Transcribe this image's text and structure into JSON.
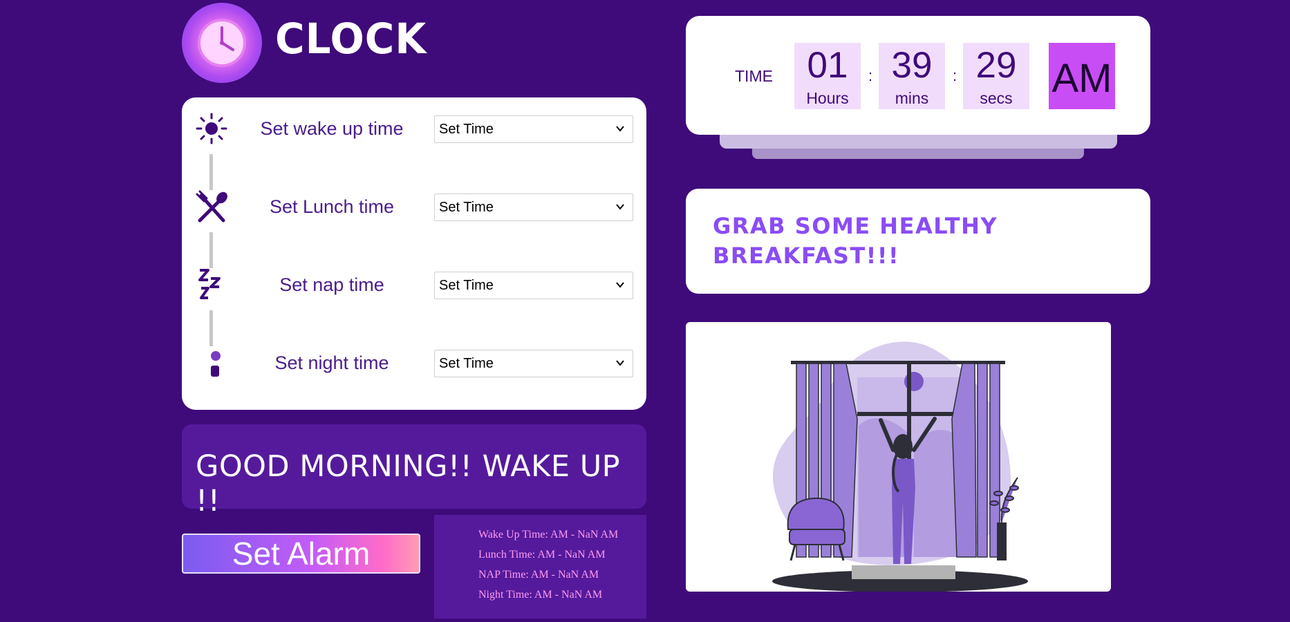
{
  "app": {
    "logo_text": "CLOCK",
    "logo_icon": "clock-icon"
  },
  "schedule": {
    "rows": [
      {
        "icon": "sun-icon",
        "label": "Set wake up time",
        "select_value": "Set Time"
      },
      {
        "icon": "fork-spoon-icon",
        "label": "Set Lunch time",
        "select_value": "Set Time"
      },
      {
        "icon": "zzz-icon",
        "label": "Set nap time",
        "select_value": "Set Time"
      },
      {
        "icon": "moon-icon",
        "label": "Set night time",
        "select_value": "Set Time"
      }
    ]
  },
  "greeting": {
    "text": "GOOD MORNING!! WAKE UP !!"
  },
  "alarm_button": {
    "label": "Set Alarm"
  },
  "alarms": [
    "Wake Up Time: AM - NaN AM",
    "Lunch Time: AM - NaN AM",
    "NAP Time: AM - NaN AM",
    "Night Time: AM - NaN AM"
  ],
  "clock": {
    "label": "TIME",
    "hours": "01",
    "hours_unit": "Hours",
    "mins": "39",
    "mins_unit": "mins",
    "secs": "29",
    "secs_unit": "secs",
    "separator": ":",
    "meridiem": "AM"
  },
  "message": {
    "text": "GRAB SOME HEALTHY BREAKFAST!!!"
  },
  "illustration": {
    "name": "woman-opening-curtains-illustration"
  },
  "colors": {
    "background": "#3f0a7a",
    "accent": "#c94df5",
    "panel": "#551a9c",
    "message": "#8a4cf5"
  }
}
